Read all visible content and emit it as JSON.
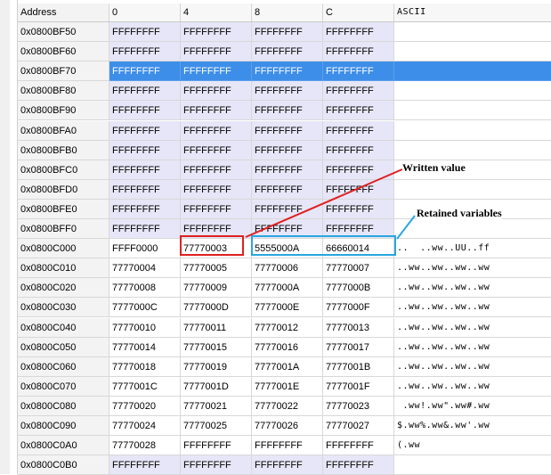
{
  "columns": [
    "Address",
    "0",
    "4",
    "8",
    "C",
    "ASCII"
  ],
  "rows": [
    {
      "address": "0x0800BF50",
      "cells": [
        "FFFFFFFF",
        "FFFFFFFF",
        "FFFFFFFF",
        "FFFFFFFF"
      ],
      "ascii": "",
      "state": "unused"
    },
    {
      "address": "0x0800BF60",
      "cells": [
        "FFFFFFFF",
        "FFFFFFFF",
        "FFFFFFFF",
        "FFFFFFFF"
      ],
      "ascii": "",
      "state": "unused"
    },
    {
      "address": "0x0800BF70",
      "cells": [
        "FFFFFFFF",
        "FFFFFFFF",
        "FFFFFFFF",
        "FFFFFFFF"
      ],
      "ascii": "",
      "state": "selected"
    },
    {
      "address": "0x0800BF80",
      "cells": [
        "FFFFFFFF",
        "FFFFFFFF",
        "FFFFFFFF",
        "FFFFFFFF"
      ],
      "ascii": "",
      "state": "unused"
    },
    {
      "address": "0x0800BF90",
      "cells": [
        "FFFFFFFF",
        "FFFFFFFF",
        "FFFFFFFF",
        "FFFFFFFF"
      ],
      "ascii": "",
      "state": "unused"
    },
    {
      "address": "0x0800BFA0",
      "cells": [
        "FFFFFFFF",
        "FFFFFFFF",
        "FFFFFFFF",
        "FFFFFFFF"
      ],
      "ascii": "",
      "state": "unused"
    },
    {
      "address": "0x0800BFB0",
      "cells": [
        "FFFFFFFF",
        "FFFFFFFF",
        "FFFFFFFF",
        "FFFFFFFF"
      ],
      "ascii": "",
      "state": "unused"
    },
    {
      "address": "0x0800BFC0",
      "cells": [
        "FFFFFFFF",
        "FFFFFFFF",
        "FFFFFFFF",
        "FFFFFFFF"
      ],
      "ascii": "",
      "state": "unused"
    },
    {
      "address": "0x0800BFD0",
      "cells": [
        "FFFFFFFF",
        "FFFFFFFF",
        "FFFFFFFF",
        "FFFFFFFF"
      ],
      "ascii": "",
      "state": "unused"
    },
    {
      "address": "0x0800BFE0",
      "cells": [
        "FFFFFFFF",
        "FFFFFFFF",
        "FFFFFFFF",
        "FFFFFFFF"
      ],
      "ascii": "",
      "state": "unused"
    },
    {
      "address": "0x0800BFF0",
      "cells": [
        "FFFFFFFF",
        "FFFFFFFF",
        "FFFFFFFF",
        "FFFFFFFF"
      ],
      "ascii": "",
      "state": "unused"
    },
    {
      "address": "0x0800C000",
      "cells": [
        "FFFF0000",
        "77770003",
        "5555000A",
        "66660014"
      ],
      "ascii": "..  ..ww..UU..ff",
      "state": "normal"
    },
    {
      "address": "0x0800C010",
      "cells": [
        "77770004",
        "77770005",
        "77770006",
        "77770007"
      ],
      "ascii": "..ww..ww..ww..ww",
      "state": "normal"
    },
    {
      "address": "0x0800C020",
      "cells": [
        "77770008",
        "77770009",
        "7777000A",
        "7777000B"
      ],
      "ascii": "..ww..ww..ww..ww",
      "state": "normal"
    },
    {
      "address": "0x0800C030",
      "cells": [
        "7777000C",
        "7777000D",
        "7777000E",
        "7777000F"
      ],
      "ascii": "..ww..ww..ww..ww",
      "state": "normal"
    },
    {
      "address": "0x0800C040",
      "cells": [
        "77770010",
        "77770011",
        "77770012",
        "77770013"
      ],
      "ascii": "..ww..ww..ww..ww",
      "state": "normal"
    },
    {
      "address": "0x0800C050",
      "cells": [
        "77770014",
        "77770015",
        "77770016",
        "77770017"
      ],
      "ascii": "..ww..ww..ww..ww",
      "state": "normal"
    },
    {
      "address": "0x0800C060",
      "cells": [
        "77770018",
        "77770019",
        "7777001A",
        "7777001B"
      ],
      "ascii": "..ww..ww..ww..ww",
      "state": "normal"
    },
    {
      "address": "0x0800C070",
      "cells": [
        "7777001C",
        "7777001D",
        "7777001E",
        "7777001F"
      ],
      "ascii": "..ww..ww..ww..ww",
      "state": "normal"
    },
    {
      "address": "0x0800C080",
      "cells": [
        "77770020",
        "77770021",
        "77770022",
        "77770023"
      ],
      "ascii": " .ww!.ww\".ww#.ww",
      "state": "normal"
    },
    {
      "address": "0x0800C090",
      "cells": [
        "77770024",
        "77770025",
        "77770026",
        "77770027"
      ],
      "ascii": "$.ww%.ww&.ww'.ww",
      "state": "normal"
    },
    {
      "address": "0x0800C0A0",
      "cells": [
        "77770028",
        "FFFFFFFF",
        "FFFFFFFF",
        "FFFFFFFF"
      ],
      "ascii": "(.ww",
      "state": "normal"
    },
    {
      "address": "0x0800C0B0",
      "cells": [
        "FFFFFFFF",
        "FFFFFFFF",
        "FFFFFFFF",
        "FFFFFFFF"
      ],
      "ascii": "",
      "state": "unused"
    }
  ],
  "annotations": {
    "written": "Written value",
    "retained": "Retained variables"
  },
  "colors": {
    "unused_cell": "#e6e6f8",
    "selection": "#3d8ee8",
    "written_box": "#e02020",
    "retained_box": "#2aa6df"
  }
}
